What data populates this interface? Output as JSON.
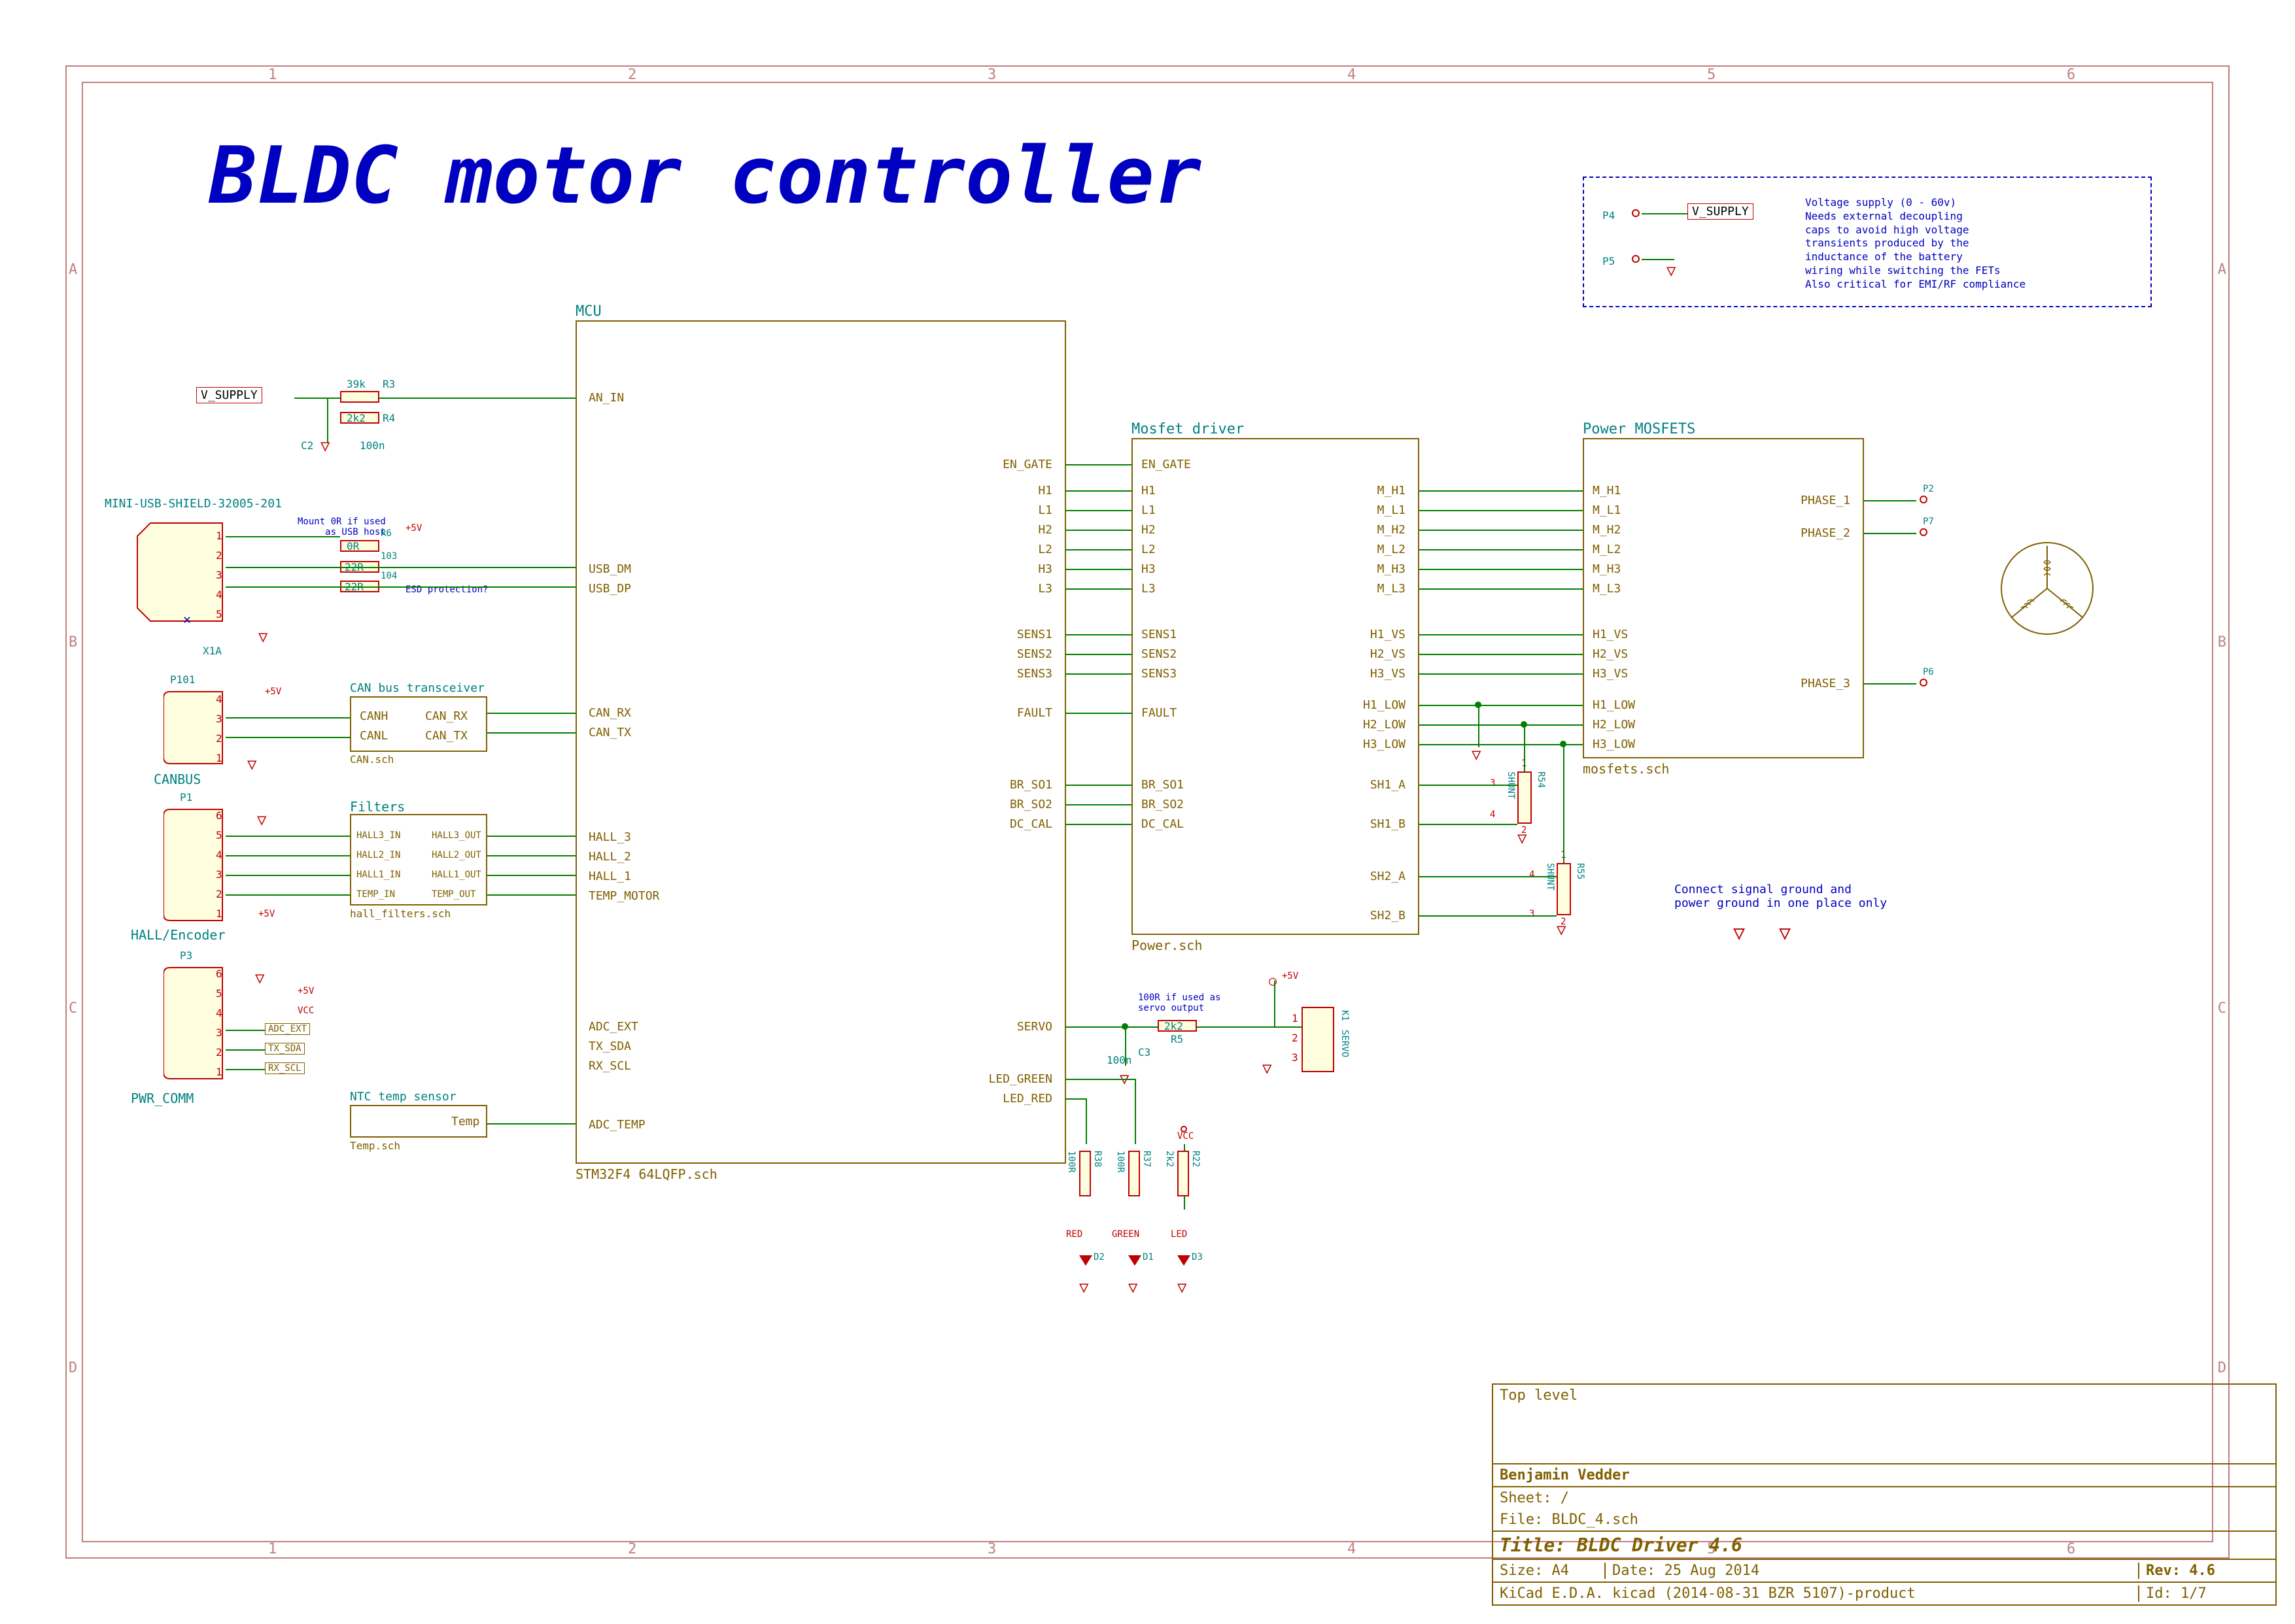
{
  "title": "BLDC motor controller",
  "frame_ticks_top": [
    "1",
    "2",
    "3",
    "4",
    "5",
    "6"
  ],
  "frame_ticks_side": [
    "A",
    "B",
    "C",
    "D"
  ],
  "supply_note": {
    "refs": [
      "P4",
      "P5"
    ],
    "net": "V_SUPPLY",
    "text": "Voltage supply (0 - 60v)\nNeeds external decoupling\ncaps to avoid high voltage\ntransients produced by the\ninductance of the battery\nwiring while switching the FETs\nAlso critical for EMI/RF compliance"
  },
  "vsupply_net": "V_SUPPLY",
  "an_in_comps": {
    "r3": {
      "ref": "R3",
      "val": "39k"
    },
    "r4": {
      "ref": "R4",
      "val": "2k2"
    },
    "c2": {
      "ref": "C2",
      "val": "100n"
    }
  },
  "usb": {
    "conn_ref": "MINI-USB-SHIELD-32005-201",
    "part_ref": "X1A",
    "pins": [
      "1",
      "2",
      "3",
      "4",
      "5"
    ],
    "r6": {
      "ref": "R6",
      "val": "0R",
      "note": "Mount 0R if used\nas USB host"
    },
    "r103": {
      "ref": "103",
      "val": "22R"
    },
    "r104": {
      "ref": "104",
      "val": "22R"
    },
    "esd_note": "ESD protection?",
    "pwr": "+5V"
  },
  "canbus": {
    "conn_ref": "P101",
    "name": "CANBUS",
    "pins": [
      "4",
      "3",
      "2",
      "1"
    ],
    "pwr": "+5V",
    "block_label": "CAN bus transceiver",
    "block_file": "CAN.sch",
    "ports_left": [
      "CANH",
      "CANL"
    ],
    "ports_right": [
      "CAN_RX",
      "CAN_TX"
    ]
  },
  "hall": {
    "conn_ref": "P1",
    "name": "HALL/Encoder",
    "pins": [
      "6",
      "5",
      "4",
      "3",
      "2",
      "1"
    ],
    "pwr": "+5V",
    "block_label": "Filters",
    "block_file": "hall_filters.sch",
    "ports_left": [
      "HALL3_IN",
      "HALL2_IN",
      "HALL1_IN",
      "TEMP_IN"
    ],
    "ports_right": [
      "HALL3_OUT",
      "HALL2_OUT",
      "HALL1_OUT",
      "TEMP_OUT"
    ]
  },
  "pwr_comm": {
    "conn_ref": "P3",
    "name": "PWR_COMM",
    "pins": [
      "6",
      "5",
      "4",
      "3",
      "2",
      "1"
    ],
    "pwr1": "+5V",
    "pwr2": "VCC",
    "nets": [
      "ADC_EXT",
      "TX_SDA",
      "RX_SCL"
    ]
  },
  "temp": {
    "block_label": "NTC temp sensor",
    "block_file": "Temp.sch",
    "port": "Temp"
  },
  "mcu": {
    "block_label": "MCU",
    "block_file": "STM32F4 64LQFP.sch",
    "ports_left": [
      "AN_IN",
      "USB_DM",
      "USB_DP",
      "CAN_RX",
      "CAN_TX",
      "HALL_3",
      "HALL_2",
      "HALL_1",
      "TEMP_MOTOR",
      "ADC_EXT",
      "TX_SDA",
      "RX_SCL",
      "ADC_TEMP"
    ],
    "ports_right": [
      "EN_GATE",
      "H1",
      "L1",
      "H2",
      "L2",
      "H3",
      "L3",
      "SENS1",
      "SENS2",
      "SENS3",
      "FAULT",
      "BR_SO1",
      "BR_SO2",
      "DC_CAL",
      "SERVO",
      "LED_GREEN",
      "LED_RED"
    ]
  },
  "mosfet_driver": {
    "block_label": "Mosfet driver",
    "block_file": "Power.sch",
    "ports_left": [
      "EN_GATE",
      "H1",
      "L1",
      "H2",
      "L2",
      "H3",
      "L3",
      "SENS1",
      "SENS2",
      "SENS3",
      "FAULT",
      "BR_SO1",
      "BR_SO2",
      "DC_CAL"
    ],
    "ports_right": [
      "M_H1",
      "M_L1",
      "M_H2",
      "M_L2",
      "M_H3",
      "M_L3",
      "H1_VS",
      "H2_VS",
      "H3_VS",
      "H1_LOW",
      "H2_LOW",
      "H3_LOW",
      "SH1_A",
      "SH1_B",
      "SH2_A",
      "SH2_B"
    ]
  },
  "power_mosfets": {
    "block_label": "Power MOSFETS",
    "block_file": "mosfets.sch",
    "ports_left": [
      "M_H1",
      "M_L1",
      "M_H2",
      "M_L2",
      "M_H3",
      "M_L3",
      "H1_VS",
      "H2_VS",
      "H3_VS",
      "H1_LOW",
      "H2_LOW",
      "H3_LOW"
    ],
    "phases": [
      "PHASE_1",
      "PHASE_2",
      "PHASE_3"
    ],
    "phase_refs": [
      "P2",
      "P7",
      "P6"
    ]
  },
  "shunts": {
    "r54": {
      "ref": "R54",
      "val": "SHUNT",
      "pins": [
        "1",
        "2",
        "3",
        "4"
      ]
    },
    "r55": {
      "ref": "R55",
      "val": "SHUNT",
      "pins": [
        "1",
        "2",
        "3",
        "4"
      ]
    }
  },
  "ground_note": "Connect signal ground and\npower ground in one place only",
  "servo": {
    "r5": {
      "ref": "R5",
      "val": "2k2",
      "note": "100R if used as\nservo output"
    },
    "c3": {
      "ref": "C3",
      "val": "100n"
    },
    "conn": {
      "ref": "K1",
      "name": "SERVO",
      "pins": [
        "1",
        "2",
        "3"
      ]
    },
    "pwr": "+5V"
  },
  "leds": {
    "r38": {
      "ref": "R38",
      "val": "100R"
    },
    "r37": {
      "ref": "R37",
      "val": "100R"
    },
    "r22": {
      "ref": "R22",
      "val": "2k2"
    },
    "d2": {
      "ref": "D2",
      "name": "RED"
    },
    "d1": {
      "ref": "D1",
      "name": "GREEN"
    },
    "d3": {
      "ref": "D3",
      "name": "LED"
    },
    "pwr": "VCC"
  },
  "titleblock": {
    "top_text": "Top level",
    "author": "Benjamin Vedder",
    "sheet": "Sheet: /",
    "file": "File: BLDC_4.sch",
    "title": "Title: BLDC Driver 4.6",
    "size": "Size: A4",
    "date": "Date: 25 Aug 2014",
    "rev": "Rev: 4.6",
    "tool": "KiCad E.D.A.  kicad (2014-08-31 BZR 5107)-product",
    "id": "Id: 1/7"
  }
}
